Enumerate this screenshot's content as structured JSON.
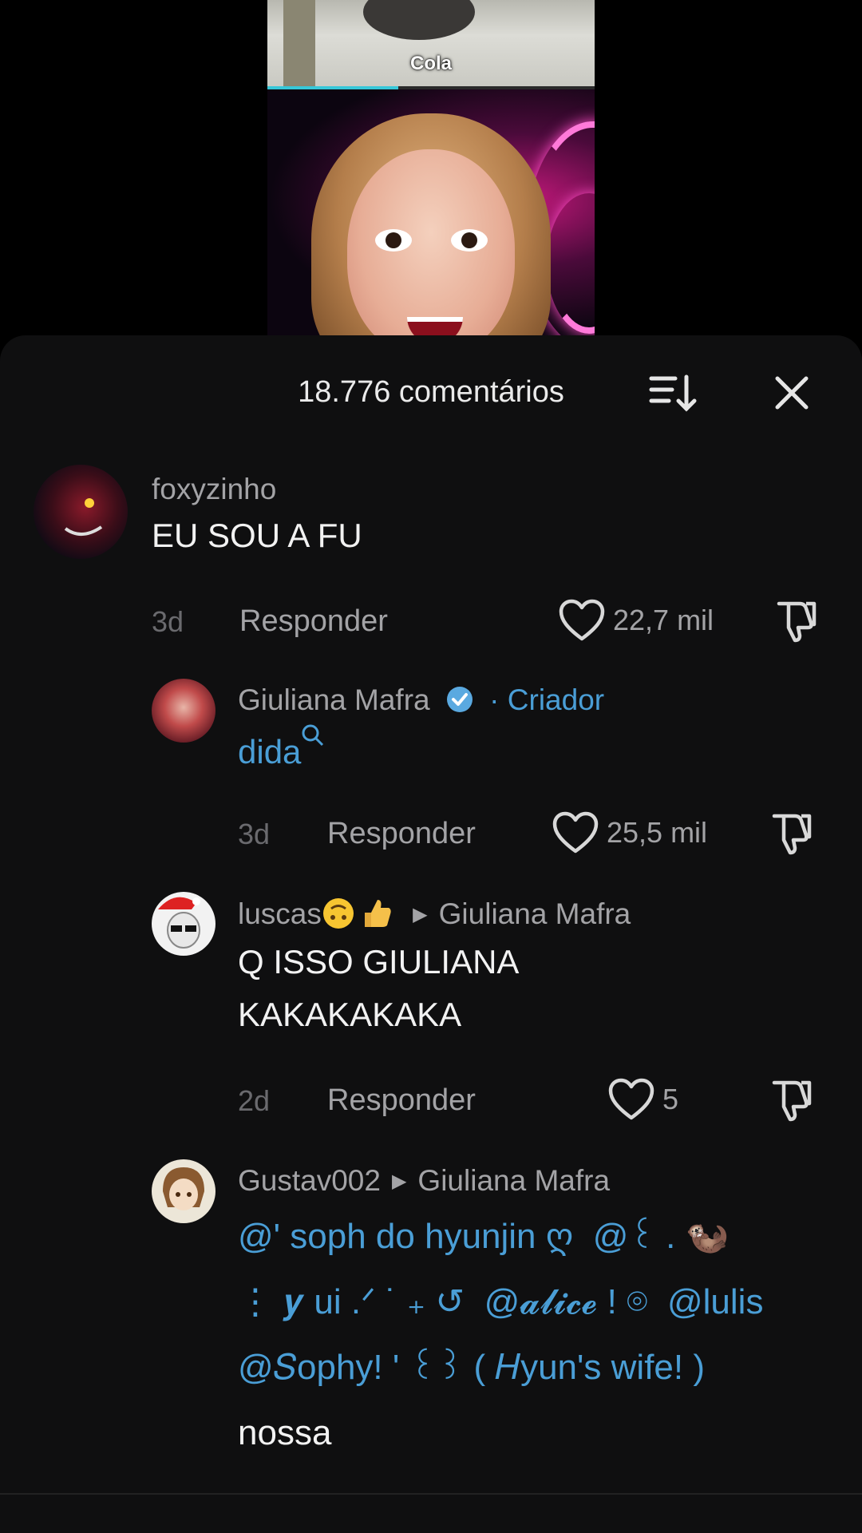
{
  "video": {
    "caption": "Cola",
    "progress": 0.4
  },
  "header": {
    "title": "18.776 comentários"
  },
  "comments": [
    {
      "username": "foxyzinho",
      "text": "EU SOU A FU",
      "time": "3d",
      "reply_label": "Responder",
      "likes": "22,7 mil"
    },
    {
      "username": "Giuliana Mafra",
      "creator_label": "· Criador",
      "text": "dida",
      "time": "3d",
      "reply_label": "Responder",
      "likes": "25,5 mil"
    },
    {
      "username": "luscas",
      "reply_to": "Giuliana Mafra",
      "text_line1": "Q ISSO GIULIANA",
      "text_line2": "KAKAKAKAKA",
      "time": "2d",
      "reply_label": "Responder",
      "likes": "5"
    },
    {
      "username": "Gustav002",
      "reply_to": "Giuliana Mafra",
      "mention1": "@' soph do hyunjin ღ",
      "mention2": "@꒰ . 🦦",
      "mention3": "⋮ 𝒚 ui .ᐟ ˙ ₊ ↺",
      "mention4": "@𝓪𝓵𝓲𝓬𝓮 ! ⌾",
      "mention5": "@lulis",
      "mention6": "@𝑆ophy! ' ꒰꒱ ( 𝐻yun's wife! )",
      "text": "nossa"
    }
  ]
}
